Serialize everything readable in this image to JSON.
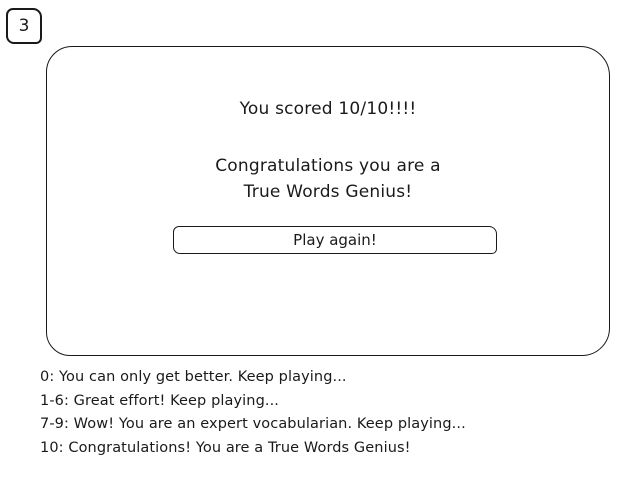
{
  "step_number": "3",
  "result": {
    "score_text": "You scored 10/10!!!!",
    "message_line1": "Congratulations you are a",
    "message_line2": "True Words Genius!",
    "play_again_label": "Play again!"
  },
  "score_legend": [
    "0: You can only get better. Keep playing...",
    "1-6: Great effort! Keep playing...",
    "7-9: Wow! You are an expert vocabularian. Keep playing...",
    "10: Congratulations! You are a True Words Genius!"
  ]
}
